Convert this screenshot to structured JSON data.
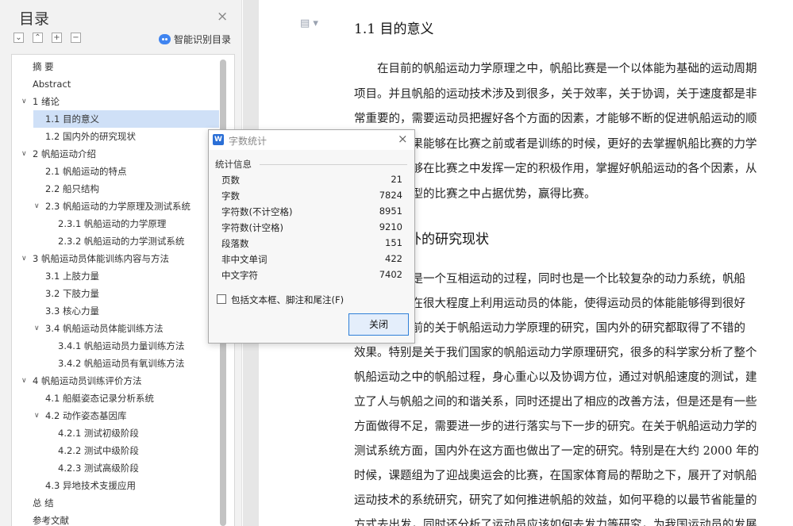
{
  "nav": {
    "title": "目录",
    "close_glyph": "×",
    "tools": [
      "⌄",
      "⌃",
      "+",
      "−"
    ],
    "ai_toc_label": "智能识别目录",
    "items": [
      {
        "label": "摘  要",
        "level": 0,
        "arrow": ""
      },
      {
        "label": "Abstract",
        "level": 0,
        "arrow": ""
      },
      {
        "label": "1 绪论",
        "level": 0,
        "arrow": "∨"
      },
      {
        "label": "1.1 目的意义",
        "level": 1,
        "arrow": "",
        "selected": true
      },
      {
        "label": "1.2 国内外的研究现状",
        "level": 1,
        "arrow": ""
      },
      {
        "label": "2 帆船运动介绍",
        "level": 0,
        "arrow": "∨"
      },
      {
        "label": "2.1 帆船运动的特点",
        "level": 1,
        "arrow": ""
      },
      {
        "label": "2.2 船只结构",
        "level": 1,
        "arrow": ""
      },
      {
        "label": "2.3 帆船运动的力学原理及测试系统",
        "level": 1,
        "arrow": "∨"
      },
      {
        "label": "2.3.1 帆船运动的力学原理",
        "level": 2,
        "arrow": ""
      },
      {
        "label": "2.3.2 帆船运动的力学测试系统",
        "level": 2,
        "arrow": ""
      },
      {
        "label": "3 帆船运动员体能训练内容与方法",
        "level": 0,
        "arrow": "∨"
      },
      {
        "label": "3.1 上肢力量",
        "level": 1,
        "arrow": ""
      },
      {
        "label": "3.2 下肢力量",
        "level": 1,
        "arrow": ""
      },
      {
        "label": "3.3 核心力量",
        "level": 1,
        "arrow": ""
      },
      {
        "label": "3.4 帆船运动员体能训练方法",
        "level": 1,
        "arrow": "∨"
      },
      {
        "label": "3.4.1 帆船运动员力量训练方法",
        "level": 2,
        "arrow": ""
      },
      {
        "label": "3.4.2 帆船运动员有氧训练方法",
        "level": 2,
        "arrow": ""
      },
      {
        "label": "4 帆船运动员训练评价方法",
        "level": 0,
        "arrow": "∨"
      },
      {
        "label": "4.1 船艇姿态记录分析系统",
        "level": 1,
        "arrow": ""
      },
      {
        "label": "4.2 动作姿态基因库",
        "level": 1,
        "arrow": "∨"
      },
      {
        "label": "4.2.1 测试初级阶段",
        "level": 2,
        "arrow": ""
      },
      {
        "label": "4.2.2 测试中级阶段",
        "level": 2,
        "arrow": ""
      },
      {
        "label": "4.2.3 测试高级阶段",
        "level": 2,
        "arrow": ""
      },
      {
        "label": "4.3 异地技术支援应用",
        "level": 1,
        "arrow": ""
      },
      {
        "label": "总  结",
        "level": 0,
        "arrow": ""
      },
      {
        "label": "参考文献",
        "level": 0,
        "arrow": ""
      }
    ]
  },
  "doc": {
    "heading1": "1.1 目的意义",
    "para1": [
      "　　在目前的帆船运动力学原理之中，帆船比赛是一个以体能为基础的运动周期",
      "项目。并且帆船的运动技术涉及到很多，关于效率，关于协调，关于速度都是非",
      "常重要的，需要运动员把握好各个方面的因素，才能够不断的促进帆船运动的顺",
      "　　　　　果能够在比赛之前或者是训练的时候，更好的去掌握帆船比赛的力学",
      "　　　　　够在比赛之中发挥一定的积极作用，掌握好帆船运动的各个因素，从",
      "　　　　　型的比赛之中占据优势，赢得比赛。"
    ],
    "heading2": "　　　　外的研究现状",
    "para2": [
      "　　　　动是一个互相运动的过程，同时也是一个比较复杂的动力系统，帆船",
      "　　　　会在很大程度上利用运动员的体能，使得运动员的体能能够得到很好",
      "　　　　目前的关于帆船运动力学原理的研究，国内外的研究都取得了不错的",
      "效果。特别是关于我们国家的帆船运动力学原理研究，很多的科学家分析了整个",
      "帆船运动之中的帆船过程，身心重心以及协调方位，通过对帆船速度的测试，建",
      "立了人与帆船之间的和谐关系，同时还提出了相应的改善方法，但是还是有一些",
      "方面做得不足，需要进一步的进行落实与下一步的研究。在关于帆船运动力学的",
      "测试系统方面，国内外在这方面也做出了一定的研究。特别是在大约 2000 年的",
      "时候，课题组为了迎战奥运会的比赛，在国家体育局的帮助之下，展开了对帆船",
      "运动技术的系统研究，研究了如何推进帆船的效益，如何平稳的以最节省能量的",
      "方式去出发，同时还分析了运动员应该如何去发力等研究，为我国运动员的发展"
    ]
  },
  "dialog": {
    "title": "字数统计",
    "close_glyph": "×",
    "app_icon": "W",
    "group_label": "统计信息",
    "stats": [
      {
        "label": "页数",
        "value": "21"
      },
      {
        "label": "字数",
        "value": "7824"
      },
      {
        "label": "字符数(不计空格)",
        "value": "8951"
      },
      {
        "label": "字符数(计空格)",
        "value": "9210"
      },
      {
        "label": "段落数",
        "value": "151"
      },
      {
        "label": "非中文单词",
        "value": "422"
      },
      {
        "label": "中文字符",
        "value": "7402"
      }
    ],
    "checkbox_label": "包括文本框、脚注和尾注(F)",
    "checkbox_checked": false,
    "button_label": "关闭"
  }
}
